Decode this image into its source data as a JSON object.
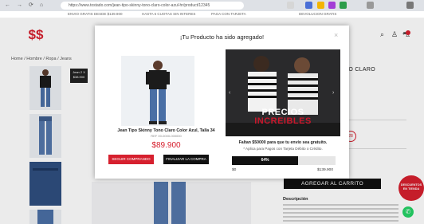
{
  "browser": {
    "url": "https://www.tostado.com/jean-tipo-skinny-tono-claro-color-azul-hr/product/12345",
    "nav_icons": [
      "back-icon",
      "forward-icon",
      "reload-icon",
      "lock-icon"
    ]
  },
  "promo_strip": {
    "items": [
      "ENVIO GRATIS DESDE $139.900",
      "HASTA 6 CUOTAS SIN INTERES",
      "PAGA CON TARJETA",
      "DEVOLUCION GRATIS"
    ]
  },
  "header": {
    "logo_text": "$$",
    "icons": [
      "search-icon",
      "user-icon",
      "cart-icon"
    ]
  },
  "breadcrumb": "Home / Hombre / Ropa / Jeans",
  "thumb_badge": "Jean 2 X $38.900",
  "product": {
    "title_partial": "NO CLARO",
    "size_selected": "28"
  },
  "add_to_cart_label": "AGREGAR AL CARRITO",
  "description_title": "Descripción",
  "floating_badge": "DESCUENTOS EN TIENDA",
  "modal": {
    "title": "¡Tu Producto ha sido agregado!",
    "close_label": "×",
    "product_name": "Jean Tipo Skinny Tono Claro Color Azul, Talla 34",
    "product_code": "REF 00-0000-000000",
    "price": "$89.900",
    "continue_label": "SEGUIR COMPRANDO",
    "finish_label": "FINALIZAR LA COMPRA",
    "promo_line1": "PRECIOS",
    "promo_line2": "INCREIBLES",
    "shipping_msg": "Faltan $50000 para que tu envío sea gratuito.",
    "shipping_note": "* Aplica para Pagos con Tarjeta Débito o Crédito.",
    "progress_percent": 64,
    "progress_label": "64%",
    "range_min": "$0",
    "range_max": "$139.900"
  },
  "colors": {
    "brand_red": "#d6202e",
    "black": "#111111",
    "whatsapp": "#25d366"
  }
}
